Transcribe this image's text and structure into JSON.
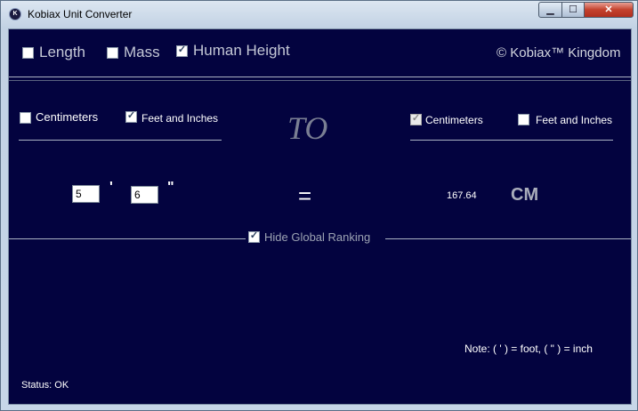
{
  "window": {
    "title": "Kobiax Unit Converter",
    "icon": "kobiax-logo-icon",
    "controls": {
      "minimize": "▁",
      "maximize": "☐",
      "close": "✕"
    }
  },
  "categories": [
    {
      "label": "Length",
      "checked": false
    },
    {
      "label": "Mass",
      "checked": false
    },
    {
      "label": "Human Height",
      "checked": true
    }
  ],
  "brand": "© Kobiax™ Kingdom",
  "from_units": [
    {
      "label": "Centimeters",
      "checked": false
    },
    {
      "label": "Feet and Inches",
      "checked": true
    }
  ],
  "to_label": "TO",
  "to_units": [
    {
      "label": "Centimeters",
      "checked": true,
      "disabled": true
    },
    {
      "label": "Feet and Inches",
      "checked": false
    }
  ],
  "inputs": {
    "feet": "5",
    "feet_mark": "'",
    "inches": "6",
    "inches_mark": "\""
  },
  "equals": "=",
  "result": {
    "value": "167.64",
    "unit": "CM"
  },
  "hide_global_ranking": {
    "label": "Hide Global Ranking",
    "checked": true
  },
  "note": "Note: ( ' ) = foot, ( \" ) = inch",
  "status": "Status: OK",
  "colors": {
    "background": "#03033f",
    "text": "#ffffff",
    "muted": "#9ca3b3"
  }
}
